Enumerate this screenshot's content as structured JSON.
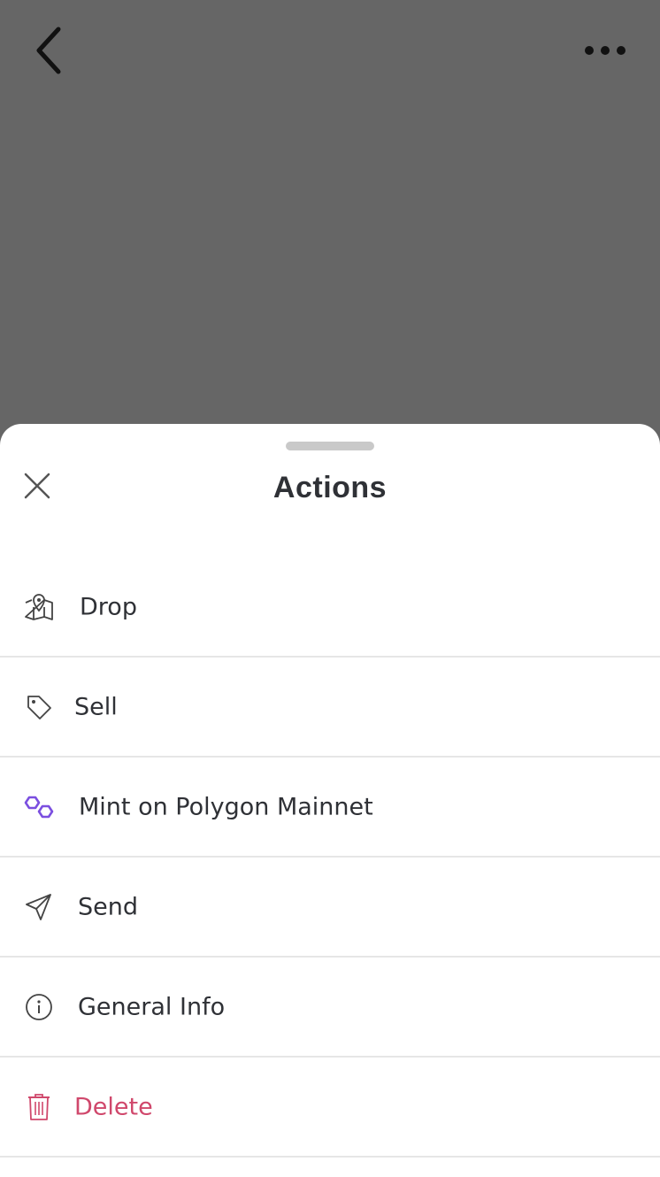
{
  "nav": {
    "back_icon": "chevron-left-icon",
    "more_icon": "ellipsis-horizontal-icon"
  },
  "sheet": {
    "title": "Actions",
    "close_icon": "close-icon",
    "items": [
      {
        "label": "Drop",
        "icon": "map-pin-icon",
        "color": "#2f3136"
      },
      {
        "label": "Sell",
        "icon": "tag-icon",
        "color": "#2f3136"
      },
      {
        "label": "Mint on Polygon Mainnet",
        "icon": "polygon-icon",
        "color": "#2f3136",
        "icon_color": "#7b4fe0"
      },
      {
        "label": "Send",
        "icon": "paper-plane-icon",
        "color": "#2f3136"
      },
      {
        "label": "General Info",
        "icon": "info-icon",
        "color": "#2f3136"
      },
      {
        "label": "Delete",
        "icon": "trash-icon",
        "color": "#d0486c"
      }
    ]
  },
  "colors": {
    "backdrop": "#666666",
    "sheet": "#ffffff",
    "text": "#2f3136",
    "danger": "#d0486c",
    "accent": "#7b4fe0",
    "divider": "#e6e6e6"
  }
}
